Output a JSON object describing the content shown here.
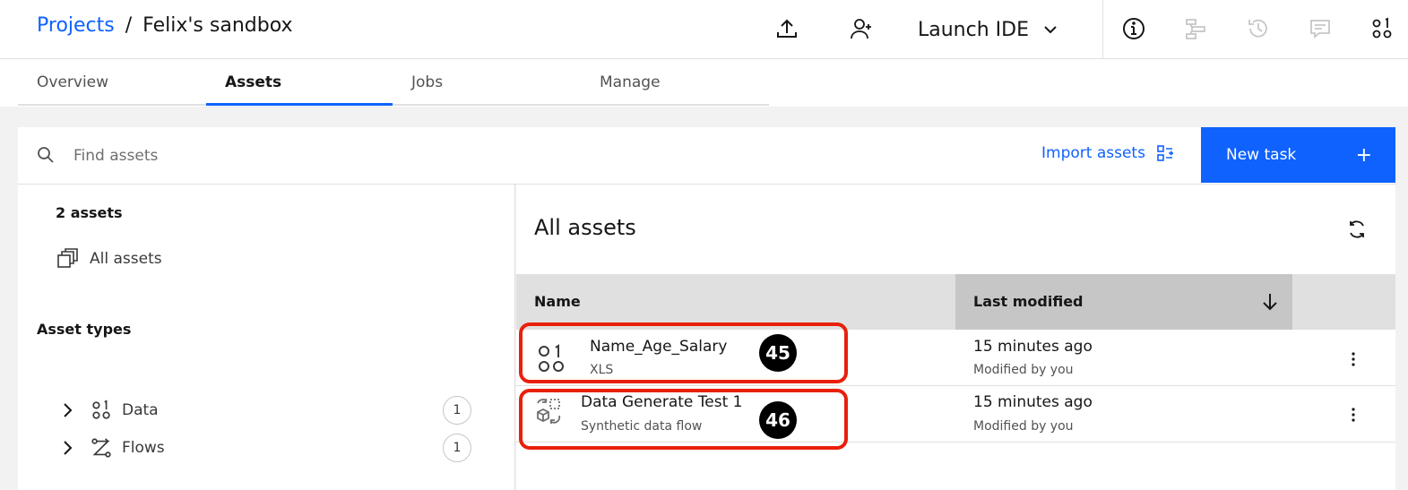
{
  "header": {
    "breadcrumb_root": "Projects",
    "breadcrumb_separator": "/",
    "project_name": "Felix's sandbox",
    "launch_ide_label": "Launch IDE",
    "icons": [
      "upload-icon",
      "add-collaborator-icon",
      "chevron-down-icon",
      "info-icon",
      "lineage-icon",
      "history-icon",
      "comments-icon",
      "data-icon"
    ]
  },
  "tabs": [
    {
      "label": "Overview",
      "active": false
    },
    {
      "label": "Assets",
      "active": true
    },
    {
      "label": "Jobs",
      "active": false
    },
    {
      "label": "Manage",
      "active": false
    }
  ],
  "toolbar": {
    "search_placeholder": "Find assets",
    "import_label": "Import assets",
    "new_task_label": "New task",
    "new_task_icon": "+"
  },
  "sidebar": {
    "assets_count": "2 assets",
    "all_assets_label": "All assets",
    "asset_types_title": "Asset types",
    "types": [
      {
        "label": "Data",
        "count": "1",
        "icon": "data-icon"
      },
      {
        "label": "Flows",
        "count": "1",
        "icon": "flows-icon"
      }
    ]
  },
  "main": {
    "title": "All assets",
    "columns": {
      "name": "Name",
      "last_modified": "Last modified"
    },
    "rows": [
      {
        "name": "Name_Age_Salary",
        "type": "XLS",
        "modified": "15 minutes ago",
        "modified_by": "Modified by you",
        "icon": "data-icon"
      },
      {
        "name": "Data Generate Test 1",
        "type": "Synthetic data flow",
        "modified": "15 minutes ago",
        "modified_by": "Modified by you",
        "icon": "synthetic-flow-icon"
      }
    ]
  },
  "annotations": {
    "badge_1": "45",
    "badge_2": "46",
    "color": "#e8200c"
  },
  "colors": {
    "accent": "#0f62fe",
    "annotation_red": "#e8200c"
  }
}
